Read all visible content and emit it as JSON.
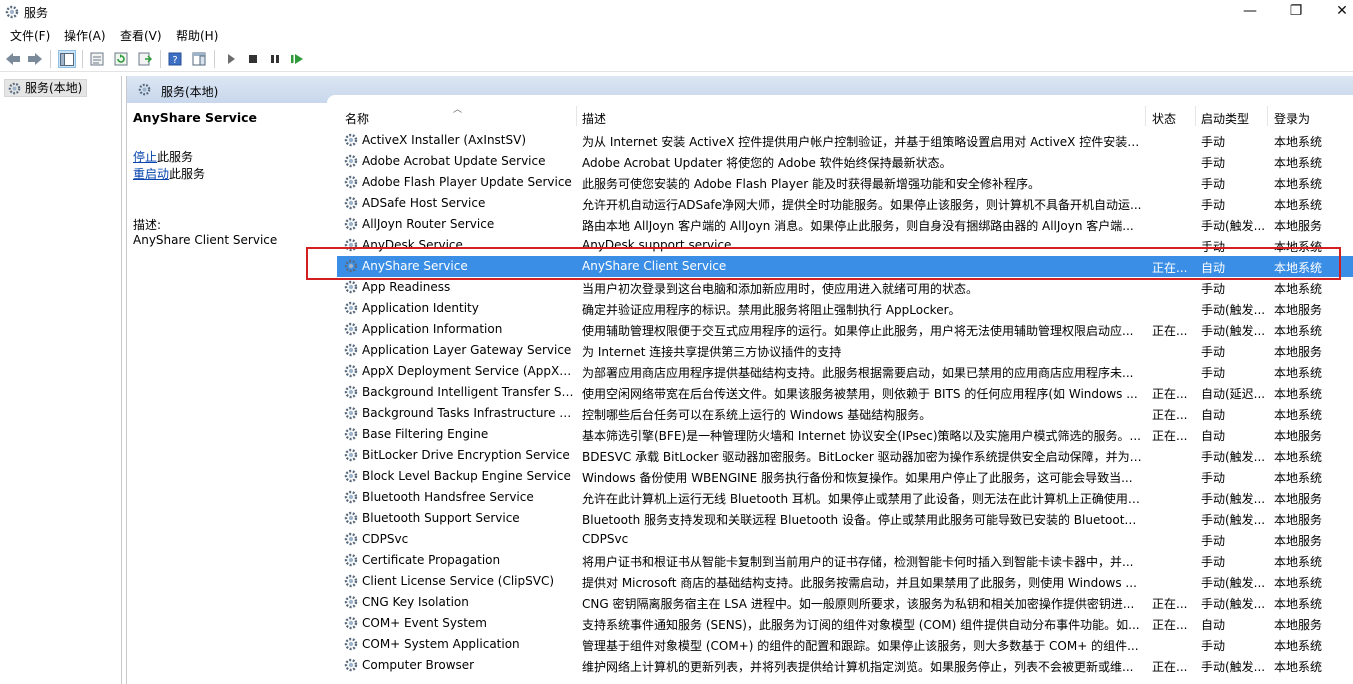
{
  "window": {
    "title": "服务",
    "min_glyph": "—",
    "max_glyph": "❐",
    "close_glyph": "✕"
  },
  "menu": [
    "文件(F)",
    "操作(A)",
    "查看(V)",
    "帮助(H)"
  ],
  "tree": {
    "root": "服务(本地)"
  },
  "pane": {
    "header": "服务(本地)",
    "selected_title": "AnyShare Service",
    "stop_link": "停止",
    "stop_suffix": "此服务",
    "restart_link": "重启动",
    "restart_suffix": "此服务",
    "desc_label": "描述:",
    "desc_value": "AnyShare Client Service"
  },
  "columns": {
    "name": "名称",
    "desc": "描述",
    "state": "状态",
    "type": "启动类型",
    "logon": "登录为"
  },
  "colors": {
    "selected_row": "#3a8ee6",
    "highlight_box": "#d21f1f",
    "link": "#0645ad"
  },
  "services": [
    {
      "name": "ActiveX Installer (AxInstSV)",
      "desc": "为从 Internet 安装 ActiveX 控件提供用户帐户控制验证，并基于组策略设置启用对 ActiveX 控件安装的...",
      "state": "",
      "type": "手动",
      "logon": "本地系统"
    },
    {
      "name": "Adobe Acrobat Update Service",
      "desc": "Adobe Acrobat Updater 将使您的 Adobe 软件始终保持最新状态。",
      "state": "",
      "type": "手动",
      "logon": "本地系统"
    },
    {
      "name": "Adobe Flash Player Update Service",
      "desc": "此服务可使您安装的 Adobe Flash Player 能及时获得最新增强功能和安全修补程序。",
      "state": "",
      "type": "手动",
      "logon": "本地系统"
    },
    {
      "name": "ADSafe Host Service",
      "desc": "允许开机自动运行ADSafe净网大师，提供全时功能服务。如果停止该服务，则计算机不具备开机自动运...",
      "state": "",
      "type": "手动",
      "logon": "本地系统"
    },
    {
      "name": "AllJoyn Router Service",
      "desc": "路由本地 AllJoyn 客户端的 AllJoyn 消息。如果停止此服务，则自身没有捆绑路由器的 AllJoyn 客户端...",
      "state": "",
      "type": "手动(触发...",
      "logon": "本地服务"
    },
    {
      "name": "AnyDesk Service",
      "desc": "AnyDesk support service.",
      "state": "",
      "type": "手动",
      "logon": "本地系统"
    },
    {
      "name": "AnyShare Service",
      "desc": "AnyShare Client Service",
      "state": "正在...",
      "type": "自动",
      "logon": "本地系统",
      "selected": true
    },
    {
      "name": "App Readiness",
      "desc": "当用户初次登录到这台电脑和添加新应用时，使应用进入就绪可用的状态。",
      "state": "",
      "type": "手动",
      "logon": "本地系统"
    },
    {
      "name": "Application Identity",
      "desc": "确定并验证应用程序的标识。禁用此服务将阻止强制执行 AppLocker。",
      "state": "",
      "type": "手动(触发...",
      "logon": "本地服务"
    },
    {
      "name": "Application Information",
      "desc": "使用辅助管理权限便于交互式应用程序的运行。如果停止此服务，用户将无法使用辅助管理权限启动应...",
      "state": "正在...",
      "type": "手动(触发...",
      "logon": "本地系统"
    },
    {
      "name": "Application Layer Gateway Service",
      "desc": "为 Internet 连接共享提供第三方协议插件的支持",
      "state": "",
      "type": "手动",
      "logon": "本地服务"
    },
    {
      "name": "AppX Deployment Service (AppXS...",
      "desc": "为部署应用商店应用程序提供基础结构支持。此服务根据需要启动，如果已禁用的应用商店应用程序未...",
      "state": "",
      "type": "手动",
      "logon": "本地系统"
    },
    {
      "name": "Background Intelligent Transfer Se...",
      "desc": "使用空闲网络带宽在后台传送文件。如果该服务被禁用，则依赖于 BITS 的任何应用程序(如 Windows ...",
      "state": "正在...",
      "type": "自动(延迟...",
      "logon": "本地系统"
    },
    {
      "name": "Background Tasks Infrastructure S...",
      "desc": "控制哪些后台任务可以在系统上运行的 Windows 基础结构服务。",
      "state": "正在...",
      "type": "自动",
      "logon": "本地系统"
    },
    {
      "name": "Base Filtering Engine",
      "desc": "基本筛选引擎(BFE)是一种管理防火墙和 Internet 协议安全(IPsec)策略以及实施用户模式筛选的服务。...",
      "state": "正在...",
      "type": "自动",
      "logon": "本地服务"
    },
    {
      "name": "BitLocker Drive Encryption Service",
      "desc": "BDESVC 承载 BitLocker 驱动器加密服务。BitLocker 驱动器加密为操作系统提供安全启动保障，并为 ...",
      "state": "",
      "type": "手动(触发...",
      "logon": "本地系统"
    },
    {
      "name": "Block Level Backup Engine Service",
      "desc": "Windows 备份使用 WBENGINE 服务执行备份和恢复操作。如果用户停止了此服务，这可能会导致当...",
      "state": "",
      "type": "手动",
      "logon": "本地系统"
    },
    {
      "name": "Bluetooth Handsfree Service",
      "desc": "允许在此计算机上运行无线 Bluetooth 耳机。如果停止或禁用了此设备，则无法在此计算机上正确使用 ...",
      "state": "",
      "type": "手动(触发...",
      "logon": "本地服务"
    },
    {
      "name": "Bluetooth Support Service",
      "desc": "Bluetooth 服务支持发现和关联远程 Bluetooth 设备。停止或禁用此服务可能导致已安装的 Bluetooth ...",
      "state": "",
      "type": "手动(触发...",
      "logon": "本地服务"
    },
    {
      "name": "CDPSvc",
      "desc": "CDPSvc",
      "state": "",
      "type": "手动",
      "logon": "本地服务"
    },
    {
      "name": "Certificate Propagation",
      "desc": "将用户证书和根证书从智能卡复制到当前用户的证书存储，检测智能卡何时插入到智能卡读卡器中，并...",
      "state": "",
      "type": "手动",
      "logon": "本地系统"
    },
    {
      "name": "Client License Service (ClipSVC)",
      "desc": "提供对 Microsoft 商店的基础结构支持。此服务按需启动，并且如果禁用了此服务，则使用 Windows ...",
      "state": "",
      "type": "手动(触发...",
      "logon": "本地系统"
    },
    {
      "name": "CNG Key Isolation",
      "desc": "CNG 密钥隔离服务宿主在 LSA 进程中。如一般原则所要求，该服务为私钥和相关加密操作提供密钥进...",
      "state": "正在...",
      "type": "手动(触发...",
      "logon": "本地系统"
    },
    {
      "name": "COM+ Event System",
      "desc": "支持系统事件通知服务 (SENS)，此服务为订阅的组件对象模型 (COM) 组件提供自动分布事件功能。如...",
      "state": "正在...",
      "type": "自动",
      "logon": "本地服务"
    },
    {
      "name": "COM+ System Application",
      "desc": "管理基于组件对象模型 (COM+) 的组件的配置和跟踪。如果停止该服务，则大多数基于 COM+ 的组件...",
      "state": "",
      "type": "手动",
      "logon": "本地系统"
    },
    {
      "name": "Computer Browser",
      "desc": "维护网络上计算机的更新列表，并将列表提供给计算机指定浏览。如果服务停止，列表不会被更新或维...",
      "state": "正在...",
      "type": "手动(触发...",
      "logon": "本地系统"
    }
  ]
}
